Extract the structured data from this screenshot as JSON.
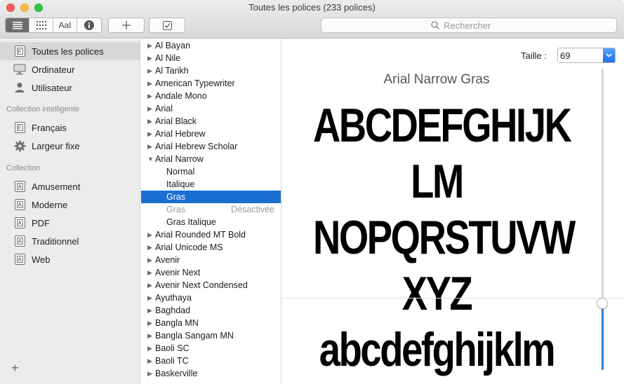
{
  "window": {
    "title": "Toutes les polices (233 polices)"
  },
  "toolbar": {
    "view_text_glyph": "AaI",
    "search_placeholder": "Rechercher",
    "icons": [
      "list-icon",
      "grid-icon",
      "sample-icon",
      "info-icon",
      "plus-icon",
      "checkbox-icon",
      "magnifier-icon"
    ]
  },
  "sidebar": {
    "library_items": [
      {
        "label": "Toutes les polices",
        "icon": "font-book-icon",
        "selected": true
      },
      {
        "label": "Ordinateur",
        "icon": "computer-icon"
      },
      {
        "label": "Utilisateur",
        "icon": "user-icon"
      }
    ],
    "smart_header": "Collection intelligente",
    "smart_items": [
      {
        "label": "Français",
        "icon": "smart-collection-icon"
      },
      {
        "label": "Largeur fixe",
        "icon": "gear-icon"
      }
    ],
    "collection_header": "Collection",
    "collection_items": [
      {
        "label": "Amusement",
        "icon": "collection-icon"
      },
      {
        "label": "Moderne",
        "icon": "collection-icon"
      },
      {
        "label": "PDF",
        "icon": "collection-icon"
      },
      {
        "label": "Traditionnel",
        "icon": "collection-icon"
      },
      {
        "label": "Web",
        "icon": "collection-icon"
      }
    ],
    "add_label": "+"
  },
  "fonts": [
    {
      "name": "Al Bayan"
    },
    {
      "name": "Al Nile"
    },
    {
      "name": "Al Tarikh"
    },
    {
      "name": "American Typewriter"
    },
    {
      "name": "Andale Mono"
    },
    {
      "name": "Arial"
    },
    {
      "name": "Arial Black"
    },
    {
      "name": "Arial Hebrew"
    },
    {
      "name": "Arial Hebrew Scholar"
    },
    {
      "name": "Arial Narrow",
      "expanded": true
    },
    {
      "name": "Normal",
      "sub": true
    },
    {
      "name": "Italique",
      "sub": true
    },
    {
      "name": "Gras",
      "sub": true,
      "selected": true
    },
    {
      "name": "Gras",
      "sub": true,
      "disabled": true,
      "badge": "Désactivée"
    },
    {
      "name": "Gras Italique",
      "sub": true
    },
    {
      "name": "Arial Rounded MT Bold"
    },
    {
      "name": "Arial Unicode MS"
    },
    {
      "name": "Avenir"
    },
    {
      "name": "Avenir Next"
    },
    {
      "name": "Avenir Next Condensed"
    },
    {
      "name": "Ayuthaya"
    },
    {
      "name": "Baghdad"
    },
    {
      "name": "Bangla MN"
    },
    {
      "name": "Bangla Sangam MN"
    },
    {
      "name": "Baoli SC"
    },
    {
      "name": "Baoli TC"
    },
    {
      "name": "Baskerville"
    }
  ],
  "preview": {
    "size_label": "Taille :",
    "size_value": "69",
    "font_name": "Arial Narrow Gras",
    "sample_lines": [
      "ABCDEFGHIJK",
      "LM",
      "NOPQRSTUVW",
      "XYZ",
      "abcdefghijklm"
    ],
    "size_level": 0.22
  },
  "colors": {
    "selection": "#1b6ed1",
    "sidebar_bg": "#ececec",
    "accent": "#2f7de1"
  }
}
